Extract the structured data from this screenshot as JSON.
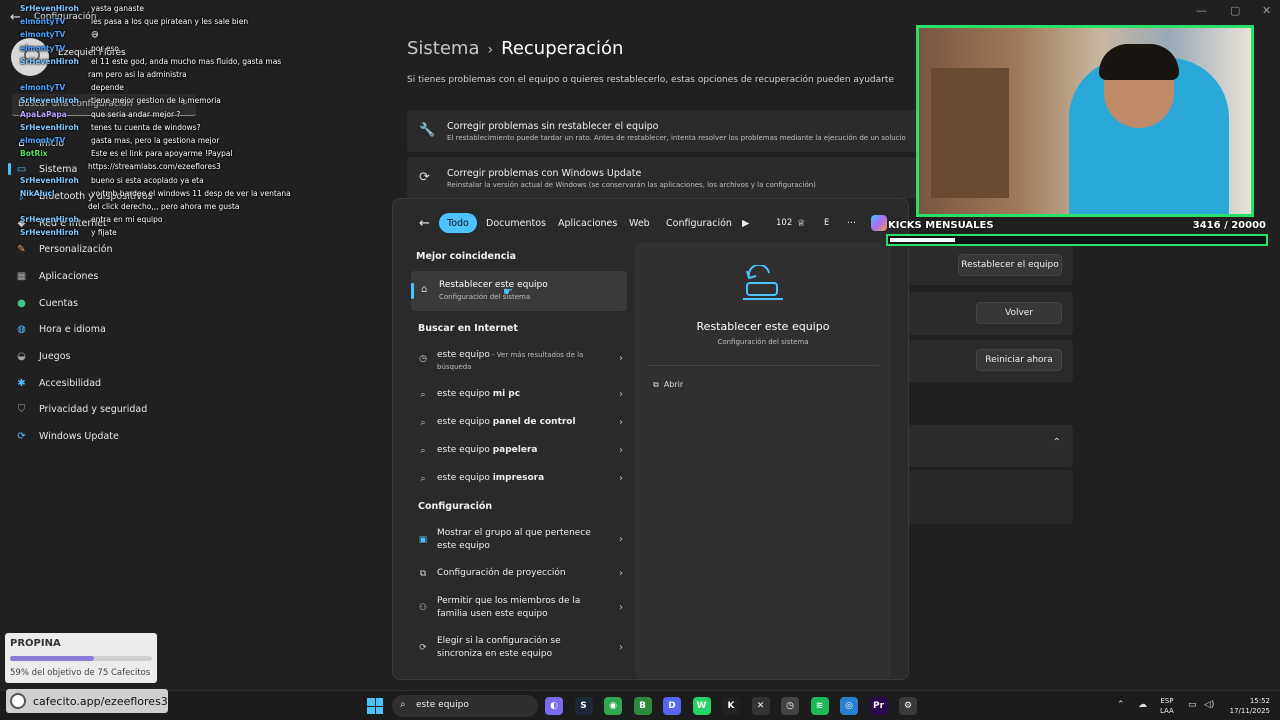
{
  "settings": {
    "app_title": "Configuración",
    "user_name": "Ezequiel Flores",
    "search_placeholder": "Buscar una configuración",
    "sidebar": [
      {
        "label": "Inicio",
        "icon": "home-icon"
      },
      {
        "label": "Sistema",
        "icon": "monitor-icon",
        "active": true
      },
      {
        "label": "Bluetooth y dispositivos",
        "icon": "bluetooth-icon"
      },
      {
        "label": "Red e Internet",
        "icon": "wifi-icon"
      },
      {
        "label": "Personalización",
        "icon": "brush-icon"
      },
      {
        "label": "Aplicaciones",
        "icon": "apps-icon"
      },
      {
        "label": "Cuentas",
        "icon": "person-icon"
      },
      {
        "label": "Hora e idioma",
        "icon": "globe-icon"
      },
      {
        "label": "Juegos",
        "icon": "gamepad-icon"
      },
      {
        "label": "Accesibilidad",
        "icon": "accessibility-icon"
      },
      {
        "label": "Privacidad y seguridad",
        "icon": "shield-icon"
      },
      {
        "label": "Windows Update",
        "icon": "sync-icon"
      }
    ],
    "breadcrumb": {
      "parent": "Sistema",
      "separator": "›",
      "current": "Recuperación"
    },
    "description": "Si tienes problemas con el equipo o quieres restablecerlo, estas opciones de recuperación pueden ayudarte",
    "cards": [
      {
        "title": "Corregir problemas sin restablecer el equipo",
        "desc": "El restablecimiento puede tardar un rato. Antes de restablecer, intenta resolver los problemas mediante la ejecución de un solucio",
        "icon": "wrench-icon"
      },
      {
        "title": "Corregir problemas con Windows Update",
        "desc": "Reinstalar la versión actual de Windows (se conservarán las aplicaciones, los archivos y la configuración)",
        "icon": "sync-icon"
      }
    ],
    "buttons": {
      "reset": "Restablecer el equipo",
      "back": "Volver",
      "restart": "Reiniciar ahora"
    }
  },
  "start": {
    "filters": [
      "Todo",
      "Documentos",
      "Aplicaciones",
      "Web",
      "Configuración"
    ],
    "points": "102",
    "initial": "E",
    "best_match_heading": "Mejor coincidencia",
    "best_match": {
      "title": "Restablecer este equipo",
      "subtitle": "Configuración del sistema"
    },
    "internet_heading": "Buscar en Internet",
    "internet_results": [
      {
        "query": "este equipo",
        "bold": "",
        "note": " - Ver más resultados de la",
        "note2": "búsqueda"
      },
      {
        "query": "este equipo ",
        "bold": "mi pc"
      },
      {
        "query": "este equipo ",
        "bold": "panel de control"
      },
      {
        "query": "este equipo ",
        "bold": "papelera"
      },
      {
        "query": "este equipo ",
        "bold": "impresora"
      }
    ],
    "config_heading": "Configuración",
    "config_results": [
      {
        "line1": "Mostrar el grupo al que pertenece",
        "line2": "este equipo"
      },
      {
        "line1": "Configuración de proyección",
        "line2": ""
      },
      {
        "line1": "Permitir que los miembros de la",
        "line2": "familia usen este equipo"
      },
      {
        "line1": "Elegir si la configuración se",
        "line2": "sincroniza en este equipo"
      }
    ],
    "preview": {
      "title": "Restablecer este equipo",
      "subtitle": "Configuración del sistema",
      "action": "Abrir"
    }
  },
  "chat": [
    {
      "user": "SrHevenHiroh",
      "color": "#7ec8ff",
      "msg": "yasta ganaste"
    },
    {
      "user": "elmontyTV",
      "color": "#4aa0ff",
      "msg": "les pasa a los que piratean y les sale bien"
    },
    {
      "user": "elmontyTV",
      "color": "#4aa0ff",
      "msg": "😅"
    },
    {
      "user": "elmontyTV",
      "color": "#4aa0ff",
      "msg": "por eso"
    },
    {
      "user": "SrHevenHiroh",
      "color": "#7ec8ff",
      "msg": "el 11 este god, anda mucho mas fluido, gasta mas"
    },
    {
      "user": "",
      "color": "#fff",
      "msg": "ram pero asi la administra"
    },
    {
      "user": "elmontyTV",
      "color": "#4aa0ff",
      "msg": "depende"
    },
    {
      "user": "SrHevenHiroh",
      "color": "#7ec8ff",
      "msg": "tiene mejor gestion de la memoria"
    },
    {
      "user": "ApaLaPapa",
      "color": "#b9a0ff",
      "msg": "que seria andar mejor ?"
    },
    {
      "user": "SrHevenHiroh",
      "color": "#7ec8ff",
      "msg": "tenes tu cuenta de windows?"
    },
    {
      "user": "elmontyTV",
      "color": "#4aa0ff",
      "msg": "gasta mas, pero la gestiona mejor"
    },
    {
      "user": "BotRix",
      "color": "#5de05d",
      "msg": "Este es el link para apoyarme !Paypal"
    },
    {
      "user": "",
      "color": "#fff",
      "msg": "https://streamlabs.com/ezeeflores3"
    },
    {
      "user": "SrHevenHiroh",
      "color": "#7ec8ff",
      "msg": "bueno si esta acoplado ya eta"
    },
    {
      "user": "NikAlucl",
      "color": "#7ec8ff",
      "msg": "yo tmb bardee el windows 11 desp de ver la ventana"
    },
    {
      "user": "",
      "color": "#fff",
      "msg": "del click derecho,,, pero ahora me gusta"
    },
    {
      "user": "SrHevenHiroh",
      "color": "#7ec8ff",
      "msg": "entra en mi equipo"
    },
    {
      "user": "SrHevenHiroh",
      "color": "#7ec8ff",
      "msg": "y fijate"
    }
  ],
  "kicks": {
    "label": "KICKS MENSUALES",
    "count": "3416  / 20000",
    "progress": 0.1708
  },
  "goal": {
    "title": "PROPINA",
    "status": "59% del objetivo de 75 Cafecitos",
    "progress": 0.59
  },
  "cafecito": "cafecito.app/ezeeflores3",
  "taskbar": {
    "search_value": "este equipo",
    "lang1": "ESP",
    "lang2": "LAA",
    "time": "15:52",
    "date": "17/11/2025",
    "apps": [
      {
        "name": "copilot-app-icon",
        "color": "#7a6cf0",
        "glyph": "◐"
      },
      {
        "name": "steam-app-icon",
        "color": "#1b2838",
        "glyph": "S"
      },
      {
        "name": "chrome-app-icon",
        "color": "#2fa84f",
        "glyph": "◉"
      },
      {
        "name": "b-app-icon",
        "color": "#2c8a3a",
        "glyph": "B"
      },
      {
        "name": "discord-app-icon",
        "color": "#5865f2",
        "glyph": "D"
      },
      {
        "name": "whatsapp-app-icon",
        "color": "#25d366",
        "glyph": "W"
      },
      {
        "name": "kick-app-icon",
        "color": "#222",
        "glyph": "K"
      },
      {
        "name": "tools-app-icon",
        "color": "#333",
        "glyph": "✕"
      },
      {
        "name": "clock-app-icon",
        "color": "#444",
        "glyph": "◷"
      },
      {
        "name": "spotify-app-icon",
        "color": "#1db954",
        "glyph": "≋"
      },
      {
        "name": "world-app-icon",
        "color": "#2a7fd0",
        "glyph": "◎"
      },
      {
        "name": "premiere-app-icon",
        "color": "#2a0a4a",
        "glyph": "Pr"
      },
      {
        "name": "gear-app-icon",
        "color": "#3a3a3a",
        "glyph": "⚙"
      }
    ]
  }
}
